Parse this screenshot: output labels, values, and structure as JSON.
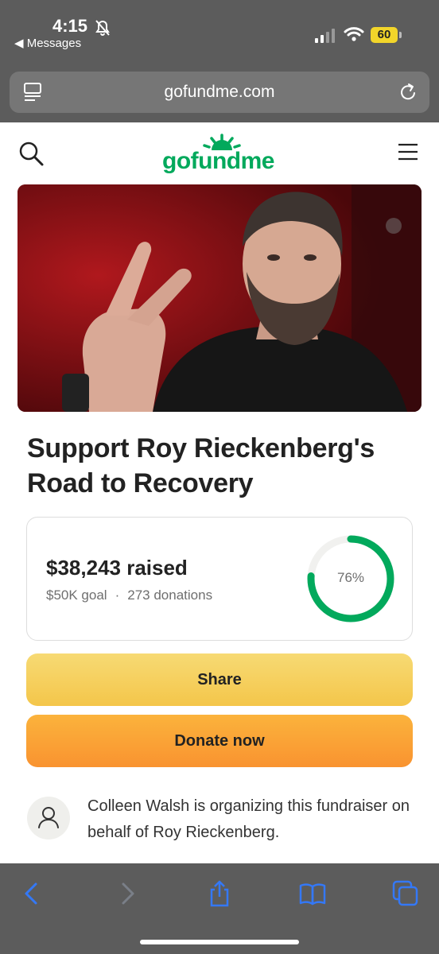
{
  "status_bar": {
    "time": "4:15",
    "back_label": "◀ Messages",
    "battery": "60"
  },
  "browser": {
    "url": "gofundme.com"
  },
  "site": {
    "logo_text": "gofundme",
    "logo_mark": "TM",
    "brand_color": "#02a95c"
  },
  "campaign": {
    "title": "Support Roy Rieckenberg's Road to Recovery",
    "raised": "$38,243 raised",
    "goal": "$50K goal",
    "donations": "273 donations",
    "separator": "·",
    "percent_label": "76%",
    "progress_fraction": 0.76
  },
  "buttons": {
    "share": "Share",
    "donate": "Donate now"
  },
  "organizer": {
    "text": "Colleen Walsh is organizing this fundraiser on behalf of Roy Rieckenberg."
  },
  "colors": {
    "share": "#f4c64a",
    "donate": "#f99330",
    "progress": "#02a95c",
    "toolbar_icon": "#3478f6"
  }
}
